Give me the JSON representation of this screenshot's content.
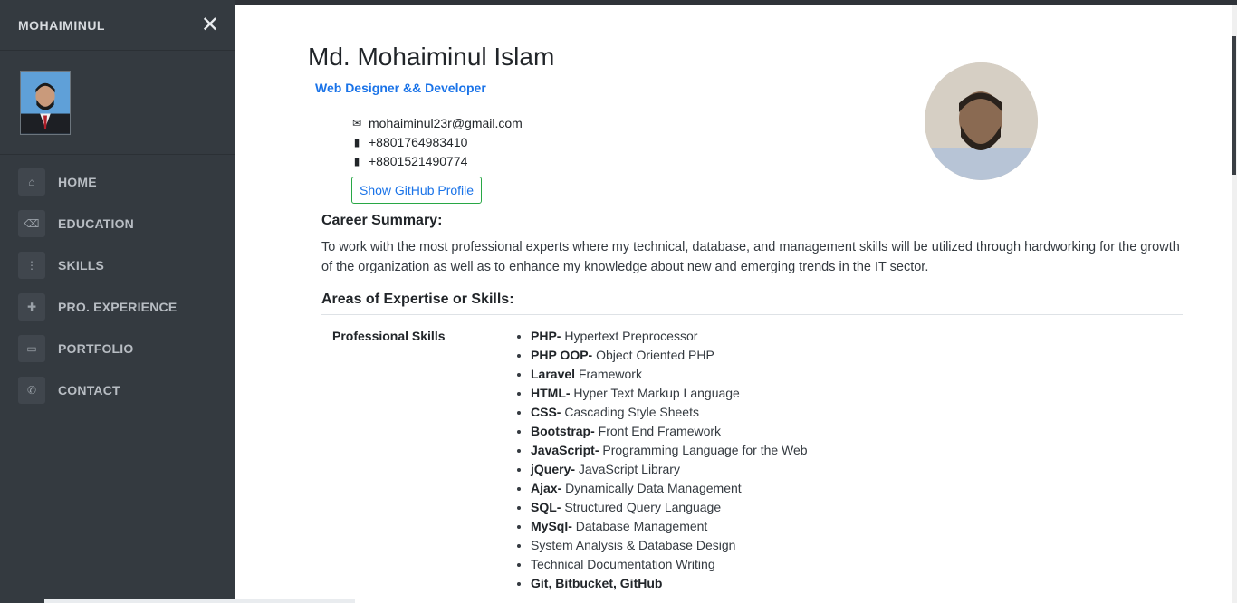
{
  "sidebar": {
    "brand": "MOHAIMINUL",
    "close_icon": "✕",
    "nav": [
      {
        "label": "HOME",
        "icon": "home-icon",
        "glyph": "⌂"
      },
      {
        "label": "EDUCATION",
        "icon": "eraser-icon",
        "glyph": "⌫"
      },
      {
        "label": "SKILLS",
        "icon": "vertical-dots-icon",
        "glyph": "⋮"
      },
      {
        "label": "PRO. EXPERIENCE",
        "icon": "puzzle-icon",
        "glyph": "✚"
      },
      {
        "label": "PORTFOLIO",
        "icon": "laptop-icon",
        "glyph": "▭"
      },
      {
        "label": "CONTACT",
        "icon": "phone-icon",
        "glyph": "✆"
      }
    ]
  },
  "profile": {
    "name": "Md. Mohaiminul Islam",
    "role": "Web Designer && Developer",
    "email": "mohaiminul23r@gmail.com",
    "phone1": "+8801764983410",
    "phone2": "+8801521490774",
    "github_label": "Show GitHub Profile",
    "email_glyph": "✉",
    "phone_glyph": "▮"
  },
  "career": {
    "heading": "Career Summary:",
    "text": "To work with the most professional experts where my technical, database, and management skills will be utilized through hardworking for the growth of the organization as well as to enhance my knowledge about new and emerging trends in the IT sector."
  },
  "skills": {
    "heading": "Areas of Expertise or Skills:",
    "category": "Professional Skills",
    "items": [
      {
        "name": "PHP-",
        "desc": " Hypertext Preprocessor"
      },
      {
        "name": "PHP OOP-",
        "desc": " Object Oriented PHP"
      },
      {
        "name": "Laravel",
        "desc": " Framework"
      },
      {
        "name": "HTML-",
        "desc": " Hyper Text Markup Language"
      },
      {
        "name": "CSS-",
        "desc": " Cascading Style Sheets"
      },
      {
        "name": "Bootstrap-",
        "desc": " Front End Framework"
      },
      {
        "name": "JavaScript-",
        "desc": " Programming Language for the Web"
      },
      {
        "name": "jQuery-",
        "desc": " JavaScript Library"
      },
      {
        "name": "Ajax-",
        "desc": " Dynamically Data Management"
      },
      {
        "name": "SQL-",
        "desc": " Structured Query Language"
      },
      {
        "name": "MySql-",
        "desc": " Database Management"
      },
      {
        "name": "",
        "desc": "System Analysis & Database Design"
      },
      {
        "name": "",
        "desc": "Technical Documentation Writing"
      },
      {
        "name": "Git, Bitbucket, GitHub",
        "desc": ""
      }
    ]
  },
  "colors": {
    "sidebar_bg": "#343a40",
    "accent_blue": "#1a73e8",
    "button_border_green": "#28a745"
  }
}
